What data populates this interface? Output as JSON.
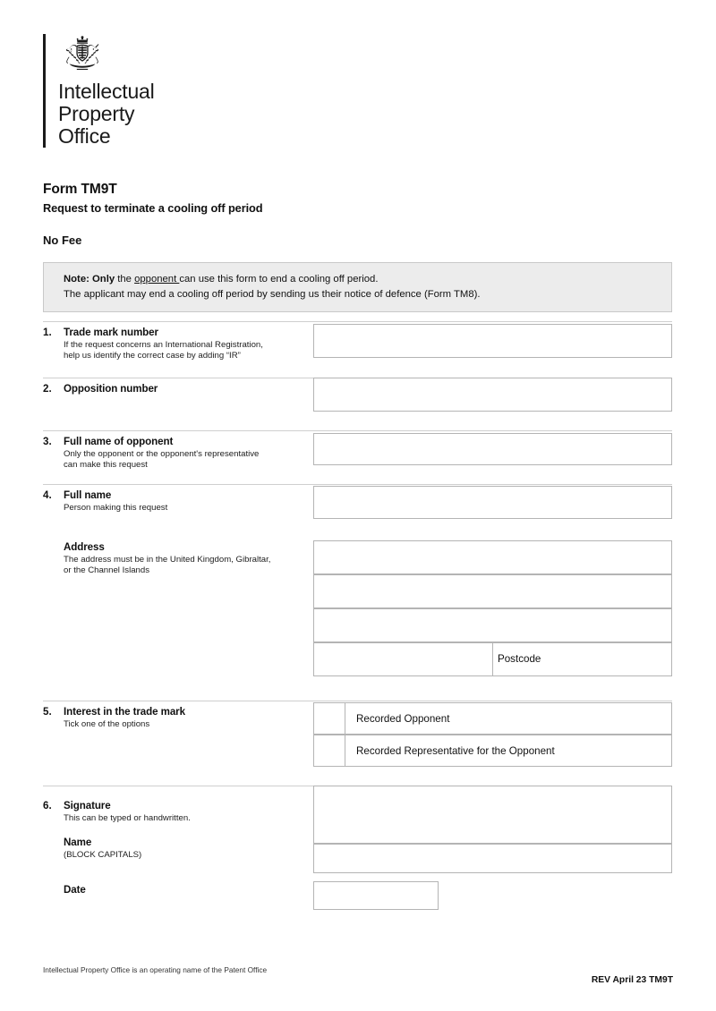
{
  "organisation": {
    "logo_lines": [
      "Intellectual",
      "Property",
      "Office"
    ],
    "crest_name": "royal-coat-of-arms-icon"
  },
  "header": {
    "form_title": "Form TM9T",
    "form_subtitle": "Request to terminate a cooling off period",
    "fee": "No Fee"
  },
  "note": {
    "line1_bold": "Note: Only",
    "line1_mid": " the ",
    "line1_underlined": "opponent ",
    "line1_rest": "can use this form to end a cooling off period.",
    "line2": "The applicant may end a cooling off period by sending us their notice of defence (Form TM8)."
  },
  "fields": {
    "trade_mark_number": {
      "number": "1.",
      "label": "Trade mark number",
      "hint_line1": "If the request concerns an International Registration,",
      "hint_line2": "help us identify the correct case by adding “IR”",
      "value": ""
    },
    "opposition_number": {
      "number": "2.",
      "label": "Opposition number",
      "value": ""
    },
    "full_name_of_opponent": {
      "number": "3.",
      "label": "Full name of opponent",
      "hint_line1": "Only the opponent or the opponent's representative",
      "hint_line2": "can make this request",
      "value": ""
    },
    "full_name": {
      "number": "4.",
      "label": "Full name",
      "hint_line1": "Person making this request",
      "value": ""
    },
    "address": {
      "label": "Address",
      "hint_line1": "The address must be in the United Kingdom, Gibraltar,",
      "hint_line2": "or the Channel Islands",
      "line1_value": "",
      "line2_value": "",
      "line3_value": "",
      "line4_value": "",
      "postcode_label": "Postcode",
      "postcode_value": ""
    },
    "interest_in_trade_mark": {
      "number": "5.",
      "label": "Interest in the trade mark",
      "hint_line1": "Tick one of the options",
      "options": [
        {
          "label": "Recorded Opponent",
          "checked": false
        },
        {
          "label": "Recorded Representative for the Opponent",
          "checked": false
        }
      ]
    },
    "signature": {
      "number": "6.",
      "label": "Signature",
      "hint_line1": "This can be typed or handwritten.",
      "value": "",
      "name_label": "Name",
      "name_hint": "(BLOCK CAPITALS)",
      "name_value": "",
      "date_label": "Date",
      "date_value": ""
    }
  },
  "footer": {
    "left": "Intellectual Property Office is an operating name of the Patent Office",
    "right": "REV April 23 TM9T"
  },
  "colors": {
    "note_background": "#ececec",
    "box_border": "#b4b4b4",
    "rule": "#cfcfcf",
    "text": "#111111"
  }
}
